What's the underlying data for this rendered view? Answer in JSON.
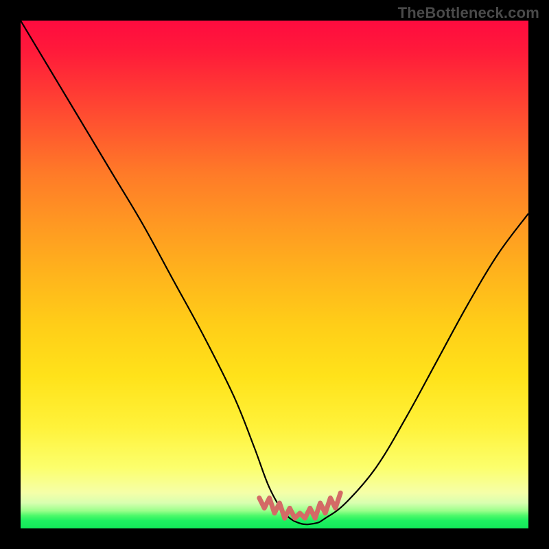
{
  "watermark": "TheBottleneck.com",
  "colors": {
    "page_bg": "#000000",
    "watermark_text": "#4a4a4a",
    "curve_stroke": "#000000",
    "jagged_stroke": "#d46a66",
    "gradient_top": "#ff0b3f",
    "gradient_mid": "#ffe21a",
    "gradient_bottom": "#12e85a"
  },
  "chart_data": {
    "type": "line",
    "title": "",
    "xlabel": "",
    "ylabel": "",
    "xlim": [
      0,
      100
    ],
    "ylim": [
      0,
      100
    ],
    "grid": false,
    "legend": false,
    "annotations": [],
    "series": [
      {
        "name": "bottleneck-curve",
        "x": [
          0,
          6,
          12,
          18,
          24,
          30,
          36,
          42,
          46,
          49,
          52,
          55,
          58,
          60,
          64,
          70,
          76,
          82,
          88,
          94,
          100
        ],
        "y": [
          100,
          90,
          80,
          70,
          60,
          49,
          38,
          26,
          16,
          8,
          3,
          1,
          1,
          2,
          5,
          12,
          22,
          33,
          44,
          54,
          62
        ]
      },
      {
        "name": "trough-jagged",
        "x": [
          47,
          48,
          49,
          50,
          51,
          52,
          53,
          54,
          55,
          56,
          57,
          58,
          59,
          60,
          61,
          62,
          63
        ],
        "y": [
          6,
          4,
          6,
          3,
          5,
          2,
          4,
          2,
          3,
          2,
          4,
          2,
          5,
          3,
          6,
          4,
          7
        ]
      }
    ]
  }
}
